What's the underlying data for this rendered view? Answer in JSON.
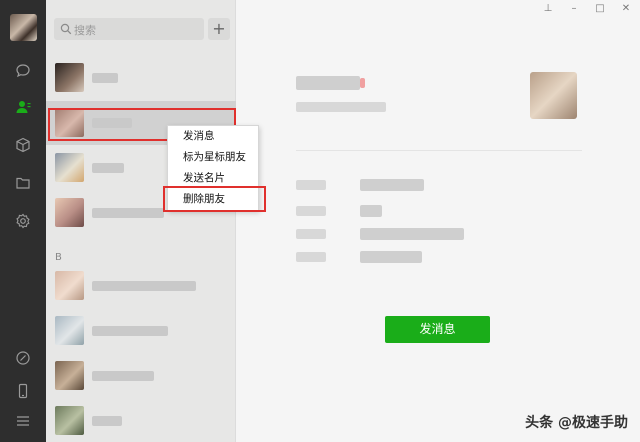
{
  "search": {
    "placeholder": "搜索"
  },
  "add_button": "+",
  "section_letter": "B",
  "context_menu": {
    "items": [
      "发消息",
      "标为星标朋友",
      "发送名片",
      "删除朋友"
    ]
  },
  "detail": {
    "send_message_label": "发消息"
  },
  "window_controls": {
    "pin": "⊥",
    "minimize": "–",
    "maximize": "□",
    "close": "✕"
  },
  "watermark": "头条 @极速手助",
  "colors": {
    "accent_green": "#1aad19",
    "highlight_red": "#e0302d",
    "rail_bg": "#2e2e2e"
  },
  "icons": [
    "chat-icon",
    "contacts-icon",
    "cube-icon",
    "folder-icon",
    "settings-icon",
    "link-icon",
    "phone-icon",
    "menu-icon"
  ]
}
